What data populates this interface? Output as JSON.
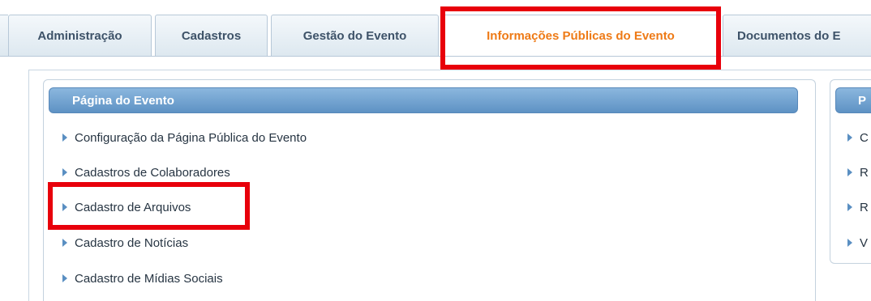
{
  "tabs": [
    {
      "label": "Administração"
    },
    {
      "label": "Cadastros"
    },
    {
      "label": "Gestão do Evento"
    },
    {
      "label": "Informações Públicas do Evento",
      "active": true
    },
    {
      "label": "Documentos do E"
    }
  ],
  "left_panel": {
    "title": "Página do Evento",
    "items": [
      {
        "label": "Configuração da Página Pública do Evento"
      },
      {
        "label": "Cadastros de Colaboradores"
      },
      {
        "label": "Cadastro de Arquivos"
      },
      {
        "label": "Cadastro de Notícias"
      },
      {
        "label": "Cadastro de Mídias Sociais"
      }
    ]
  },
  "right_panel": {
    "title": "P",
    "items": [
      {
        "label": "C"
      },
      {
        "label": "R"
      },
      {
        "label": "R"
      },
      {
        "label": "V"
      }
    ]
  },
  "colors": {
    "highlight": "#e8000b",
    "active_tab_text": "#ee7a16",
    "panel_header": "#6f9fcf"
  },
  "icons": {
    "list_bullet": "triangle-right-icon"
  }
}
